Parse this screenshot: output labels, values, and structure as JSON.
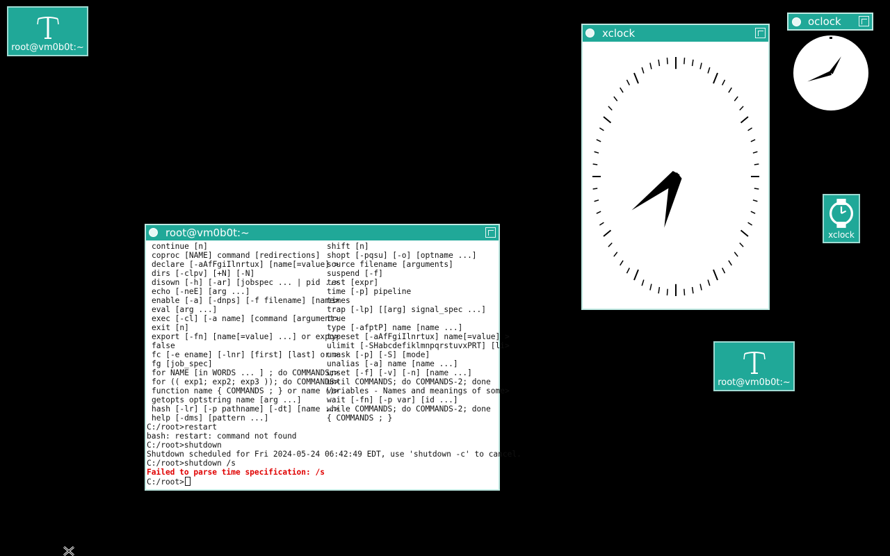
{
  "desktop": {
    "icons": [
      {
        "label": "root@vm0b0t:~"
      },
      {
        "label": "root@vm0b0t:~"
      },
      {
        "label": "xclock"
      }
    ]
  },
  "terminal": {
    "title": "root@vm0b0t:~",
    "help_left": [
      "continue [n]",
      "coproc [NAME] command [redirections]",
      "declare [-aAfFgiIlnrtux] [name[=value] >",
      "dirs [-clpv] [+N] [-N]",
      "disown [-h] [-ar] [jobspec ... | pid ..>",
      "echo [-neE] [arg ...]",
      "enable [-a] [-dnps] [-f filename] [name>",
      "eval [arg ...]",
      "exec [-cl] [-a name] [command [argument>",
      "exit [n]",
      "export [-fn] [name[=value] ...] or expo>",
      "false",
      "fc [-e ename] [-lnr] [first] [last] or >",
      "fg [job_spec]",
      "for NAME [in WORDS ... ] ; do COMMANDS;>",
      "for (( exp1; exp2; exp3 )); do COMMANDS>",
      "function name { COMMANDS ; } or name ()>",
      "getopts optstring name [arg ...]",
      "hash [-lr] [-p pathname] [-dt] [name ..>",
      "help [-dms] [pattern ...]"
    ],
    "help_right": [
      "shift [n]",
      "shopt [-pqsu] [-o] [optname ...]",
      "source filename [arguments]",
      "suspend [-f]",
      "test [expr]",
      "time [-p] pipeline",
      "times",
      "trap [-lp] [[arg] signal_spec ...]",
      "true",
      "type [-afptP] name [name ...]",
      "typeset [-aAfFgiIlnrtux] name[=value] >",
      "ulimit [-SHabcdefiklmnpqrstuvxPRT] [li>",
      "umask [-p] [-S] [mode]",
      "unalias [-a] name [name ...]",
      "unset [-f] [-v] [-n] [name ...]",
      "until COMMANDS; do COMMANDS-2; done",
      "variables - Names and meanings of some>",
      "wait [-fn] [-p var] [id ...]",
      "while COMMANDS; do COMMANDS-2; done",
      "{ COMMANDS ; }"
    ],
    "output": [
      "C:/root>restart",
      "bash: restart: command not found",
      "C:/root>shutdown",
      "Shutdown scheduled for Fri 2024-05-24 06:42:49 EDT, use 'shutdown -c' to cancel.",
      "C:/root>shutdown /s"
    ],
    "error_line": "Failed to parse time specification: /s",
    "prompt": "C:/root>",
    "error_color": "#e00000"
  },
  "xclock": {
    "title": "xclock",
    "hour_angle_deg": 242,
    "minute_angle_deg": 198
  },
  "oclock": {
    "title": "oclock",
    "hour_angle_deg": 250,
    "minute_angle_deg": 32
  },
  "colors": {
    "titlebar": "#20a898",
    "background": "#000000"
  }
}
